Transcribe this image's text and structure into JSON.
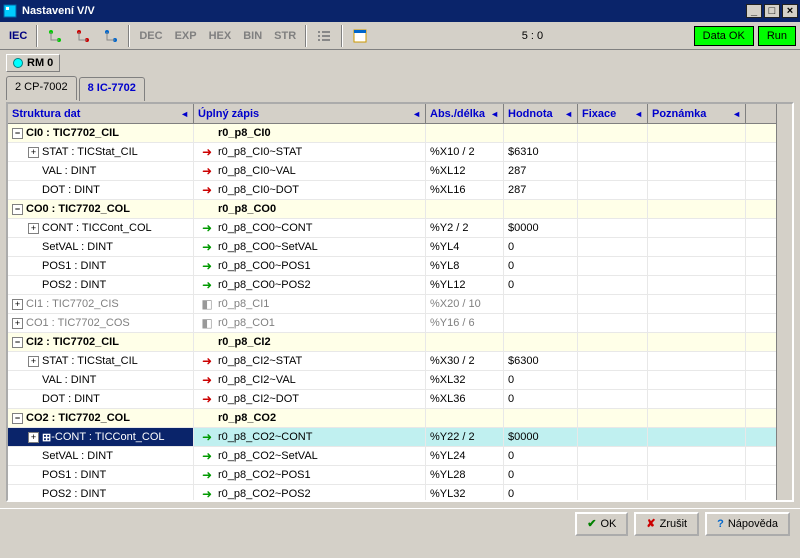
{
  "window": {
    "title": "Nastavení V/V"
  },
  "toolbar": {
    "iec": "IEC",
    "dec": "DEC",
    "exp": "EXP",
    "hex": "HEX",
    "bin": "BIN",
    "str": "STR",
    "status": "5 : 0",
    "data_ok": "Data OK",
    "run": "Run"
  },
  "rm_tab": "RM 0",
  "tabs": [
    {
      "label": "2 CP-7002",
      "active": false
    },
    {
      "label": "8 IC-7702",
      "active": true
    }
  ],
  "columns": {
    "c0": "Struktura dat",
    "c1": "Úplný zápis",
    "c2": "Abs./délka",
    "c3": "Hodnota",
    "c4": "Fixace",
    "c5": "Poznámka"
  },
  "rows": [
    {
      "d": 0,
      "exp": "-",
      "bold": true,
      "alt": true,
      "icon": "",
      "t0": "CI0  : TIC7702_CIL",
      "t1": "r0_p8_CI0",
      "t2": "",
      "t3": ""
    },
    {
      "d": 1,
      "exp": "+",
      "icon": "r",
      "t0": "STAT  : TICStat_CIL",
      "t1": "r0_p8_CI0~STAT",
      "t2": "%X10 / 2",
      "t3": "$6310"
    },
    {
      "d": 1,
      "exp": "",
      "icon": "r",
      "t0": "VAL  : DINT",
      "t1": "r0_p8_CI0~VAL",
      "t2": "%XL12",
      "t3": "287"
    },
    {
      "d": 1,
      "exp": "",
      "icon": "r",
      "t0": "DOT  : DINT",
      "t1": "r0_p8_CI0~DOT",
      "t2": "%XL16",
      "t3": "287"
    },
    {
      "d": 0,
      "exp": "-",
      "bold": true,
      "alt": true,
      "icon": "",
      "t0": "CO0  : TIC7702_COL",
      "t1": "r0_p8_CO0",
      "t2": "",
      "t3": ""
    },
    {
      "d": 1,
      "exp": "+",
      "icon": "g",
      "t0": "CONT  : TICCont_COL",
      "t1": "r0_p8_CO0~CONT",
      "t2": "%Y2 / 2",
      "t3": "$0000"
    },
    {
      "d": 1,
      "exp": "",
      "icon": "g",
      "t0": "SetVAL  : DINT",
      "t1": "r0_p8_CO0~SetVAL",
      "t2": "%YL4",
      "t3": "0"
    },
    {
      "d": 1,
      "exp": "",
      "icon": "g",
      "t0": "POS1  : DINT",
      "t1": "r0_p8_CO0~POS1",
      "t2": "%YL8",
      "t3": "0"
    },
    {
      "d": 1,
      "exp": "",
      "icon": "g",
      "t0": "POS2  : DINT",
      "t1": "r0_p8_CO0~POS2",
      "t2": "%YL12",
      "t3": "0"
    },
    {
      "d": 0,
      "exp": "+",
      "dim": true,
      "icon": "x",
      "t0": "CI1  : TIC7702_CIS",
      "t1": "r0_p8_CI1",
      "t2": "%X20 / 10",
      "t3": ""
    },
    {
      "d": 0,
      "exp": "+",
      "dim": true,
      "icon": "x",
      "t0": "CO1  : TIC7702_COS",
      "t1": "r0_p8_CO1",
      "t2": "%Y16 / 6",
      "t3": ""
    },
    {
      "d": 0,
      "exp": "-",
      "bold": true,
      "alt": true,
      "icon": "",
      "t0": "CI2  : TIC7702_CIL",
      "t1": "r0_p8_CI2",
      "t2": "",
      "t3": ""
    },
    {
      "d": 1,
      "exp": "+",
      "icon": "r",
      "t0": "STAT  : TICStat_CIL",
      "t1": "r0_p8_CI2~STAT",
      "t2": "%X30 / 2",
      "t3": "$6300"
    },
    {
      "d": 1,
      "exp": "",
      "icon": "r",
      "t0": "VAL  : DINT",
      "t1": "r0_p8_CI2~VAL",
      "t2": "%XL32",
      "t3": "0"
    },
    {
      "d": 1,
      "exp": "",
      "icon": "r",
      "t0": "DOT  : DINT",
      "t1": "r0_p8_CI2~DOT",
      "t2": "%XL36",
      "t3": "0"
    },
    {
      "d": 0,
      "exp": "-",
      "bold": true,
      "alt": true,
      "icon": "",
      "t0": "CO2  : TIC7702_COL",
      "t1": "r0_p8_CO2",
      "t2": "",
      "t3": ""
    },
    {
      "d": 1,
      "exp": "+",
      "icon": "g",
      "sel": true,
      "hl": true,
      "t0": "CONT  : TICCont_COL",
      "t1": "r0_p8_CO2~CONT",
      "t2": "%Y22 / 2",
      "t3": "$0000"
    },
    {
      "d": 1,
      "exp": "",
      "icon": "g",
      "t0": "SetVAL  : DINT",
      "t1": "r0_p8_CO2~SetVAL",
      "t2": "%YL24",
      "t3": "0"
    },
    {
      "d": 1,
      "exp": "",
      "icon": "g",
      "t0": "POS1  : DINT",
      "t1": "r0_p8_CO2~POS1",
      "t2": "%YL28",
      "t3": "0"
    },
    {
      "d": 1,
      "exp": "",
      "icon": "g",
      "t0": "POS2  : DINT",
      "t1": "r0_p8_CO2~POS2",
      "t2": "%YL32",
      "t3": "0"
    }
  ],
  "footer": {
    "ok": "OK",
    "cancel": "Zrušit",
    "help": "Nápověda"
  }
}
